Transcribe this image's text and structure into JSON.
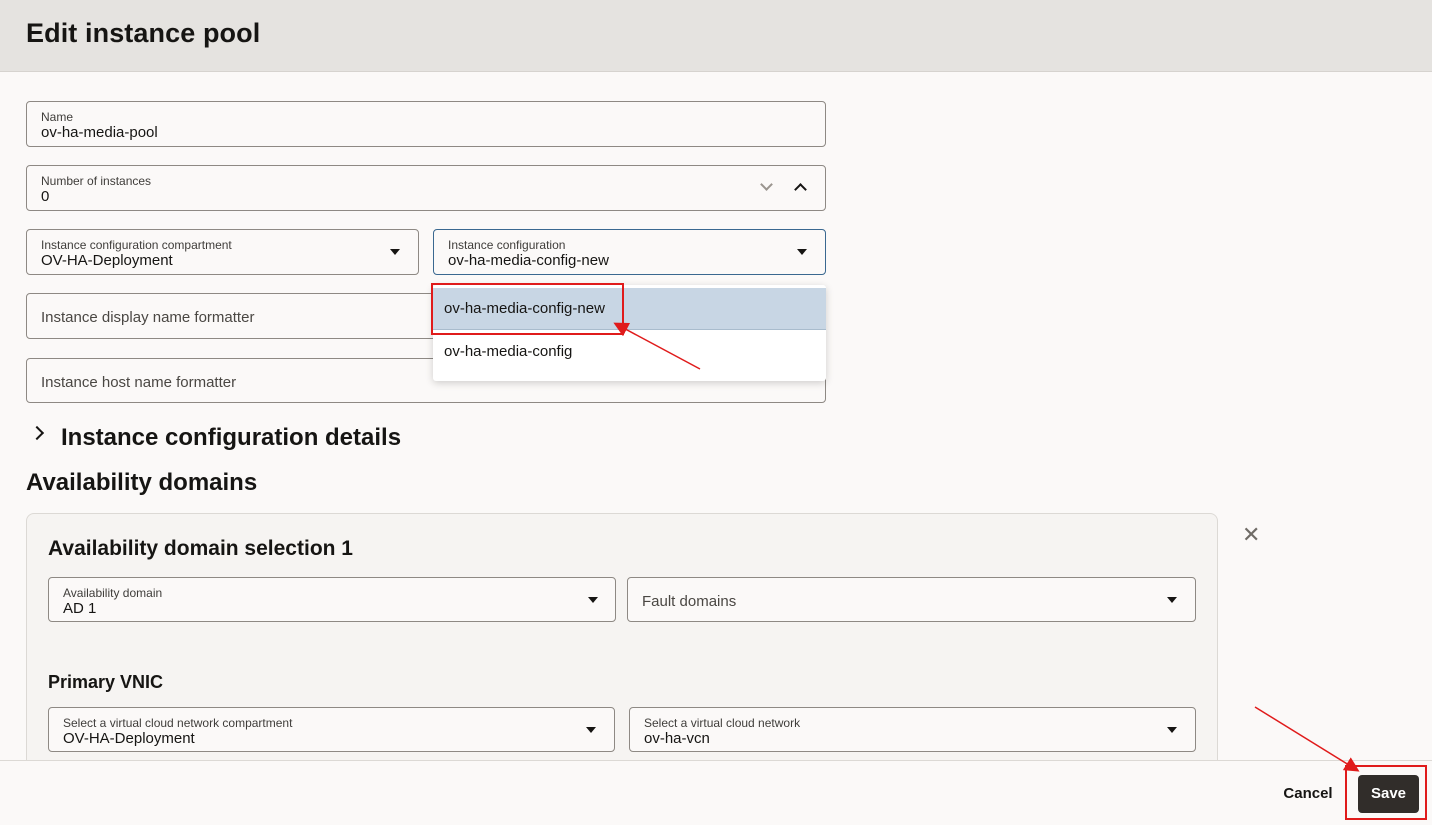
{
  "header": {
    "title": "Edit instance pool"
  },
  "form": {
    "name": {
      "label": "Name",
      "value": "ov-ha-media-pool"
    },
    "instances": {
      "label": "Number of instances",
      "value": "0"
    },
    "compartment": {
      "label": "Instance configuration compartment",
      "value": "OV-HA-Deployment"
    },
    "instance_config": {
      "label": "Instance configuration",
      "value": "ov-ha-media-config-new"
    },
    "display_name_formatter": {
      "placeholder": "Instance display name formatter"
    },
    "host_name_formatter": {
      "placeholder": "Instance host name formatter"
    }
  },
  "dropdown": {
    "options": [
      "ov-ha-media-config-new",
      "ov-ha-media-config"
    ],
    "selected": "ov-ha-media-config-new"
  },
  "sections": {
    "config_details": "Instance configuration details",
    "availability_domains": "Availability domains"
  },
  "ad_card": {
    "title": "Availability domain selection 1",
    "ad": {
      "label": "Availability domain",
      "value": "AD 1"
    },
    "fault_domains": {
      "placeholder": "Fault domains"
    },
    "vnic_title": "Primary VNIC",
    "vcn_compartment": {
      "label": "Select a virtual cloud network compartment",
      "value": "OV-HA-Deployment"
    },
    "vcn": {
      "label": "Select a virtual cloud network",
      "value": "ov-ha-vcn"
    }
  },
  "footer": {
    "cancel_label": "Cancel",
    "save_label": "Save"
  },
  "colors": {
    "accent": "#3a6890",
    "annotation": "#e01b1b",
    "primary_button": "#312d2a"
  },
  "icons": [
    "chevron-down-icon",
    "chevron-up-icon",
    "caret-down-icon",
    "chevron-right-icon",
    "close-icon"
  ]
}
